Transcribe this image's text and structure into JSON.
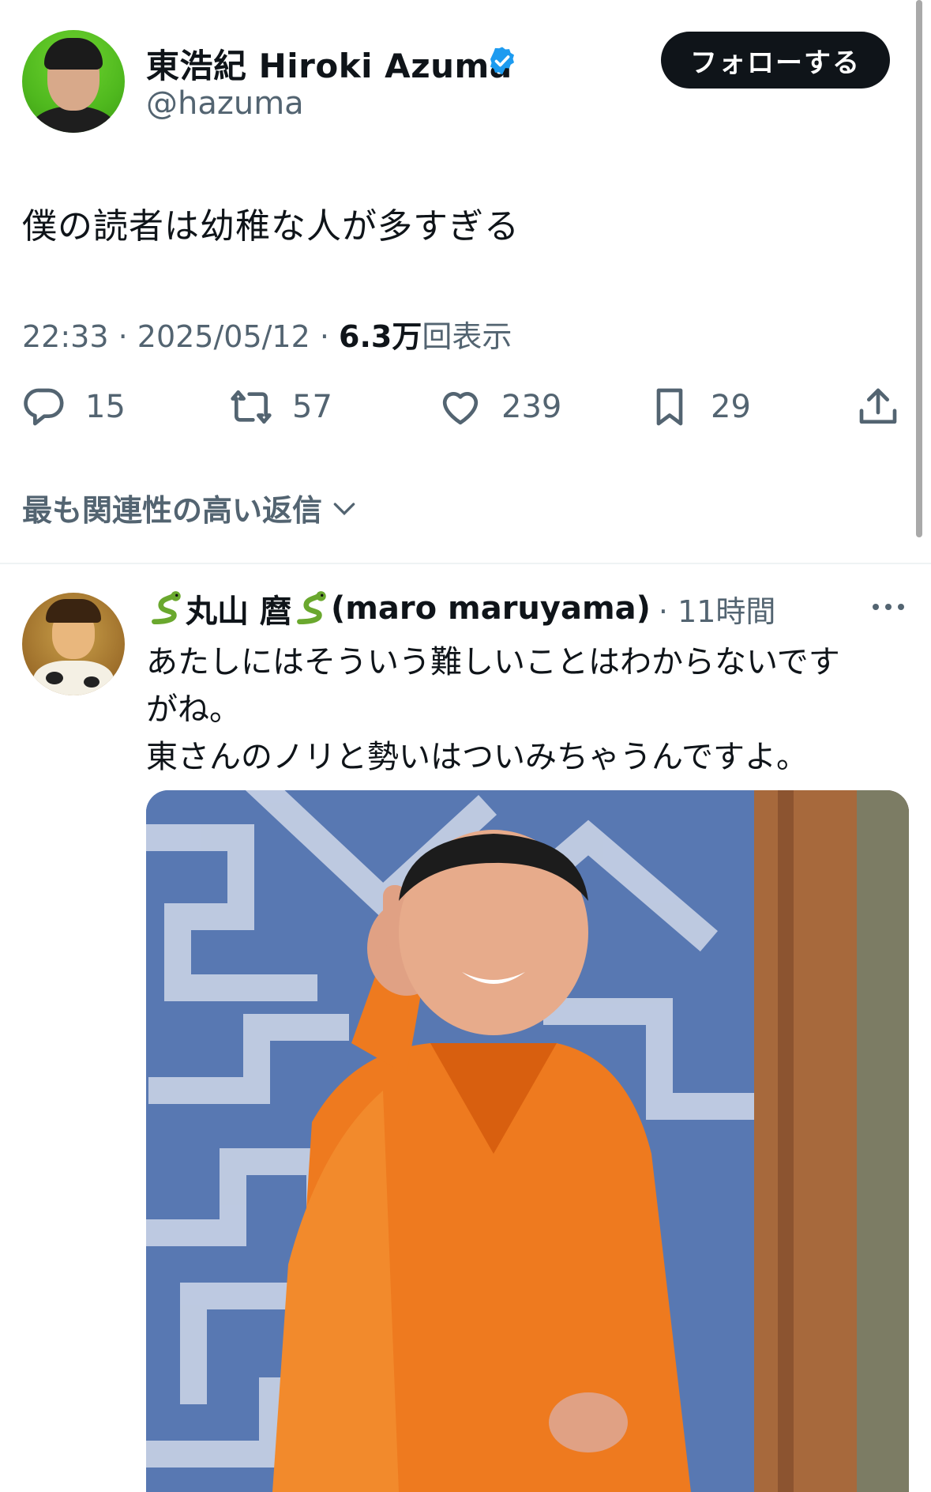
{
  "tweet": {
    "author_name": "東浩紀 Hiroki Azuma",
    "author_handle": "@hazuma",
    "follow_label": "フォローする",
    "text": "僕の読者は幼稚な人が多すぎる",
    "time": "22:33",
    "date": "2025/05/12",
    "views_count": "6.3万",
    "views_label": "回表示",
    "separator": " · ",
    "replies": "15",
    "retweets": "57",
    "likes": "239",
    "bookmarks": "29"
  },
  "replies_sort_label": "最も関連性の高い返信",
  "reply": {
    "author_name": "丸山 麿",
    "author_name_suffix": "(maro maruyama)",
    "time": "· 11時間",
    "text_lines": [
      "あたしにはそういう難しいことはわからないです",
      "がね。",
      "東さんのノリと勢いはついみちゃうんですよ。"
    ]
  },
  "colors": {
    "verified": "#1d9bf0",
    "follow_bg": "#0f1419",
    "muted": "#536471"
  },
  "icons": [
    "verified-badge-icon",
    "reply-icon",
    "retweet-icon",
    "like-icon",
    "bookmark-icon",
    "share-icon",
    "chevron-down-icon",
    "snake-emoji-icon",
    "more-icon"
  ]
}
